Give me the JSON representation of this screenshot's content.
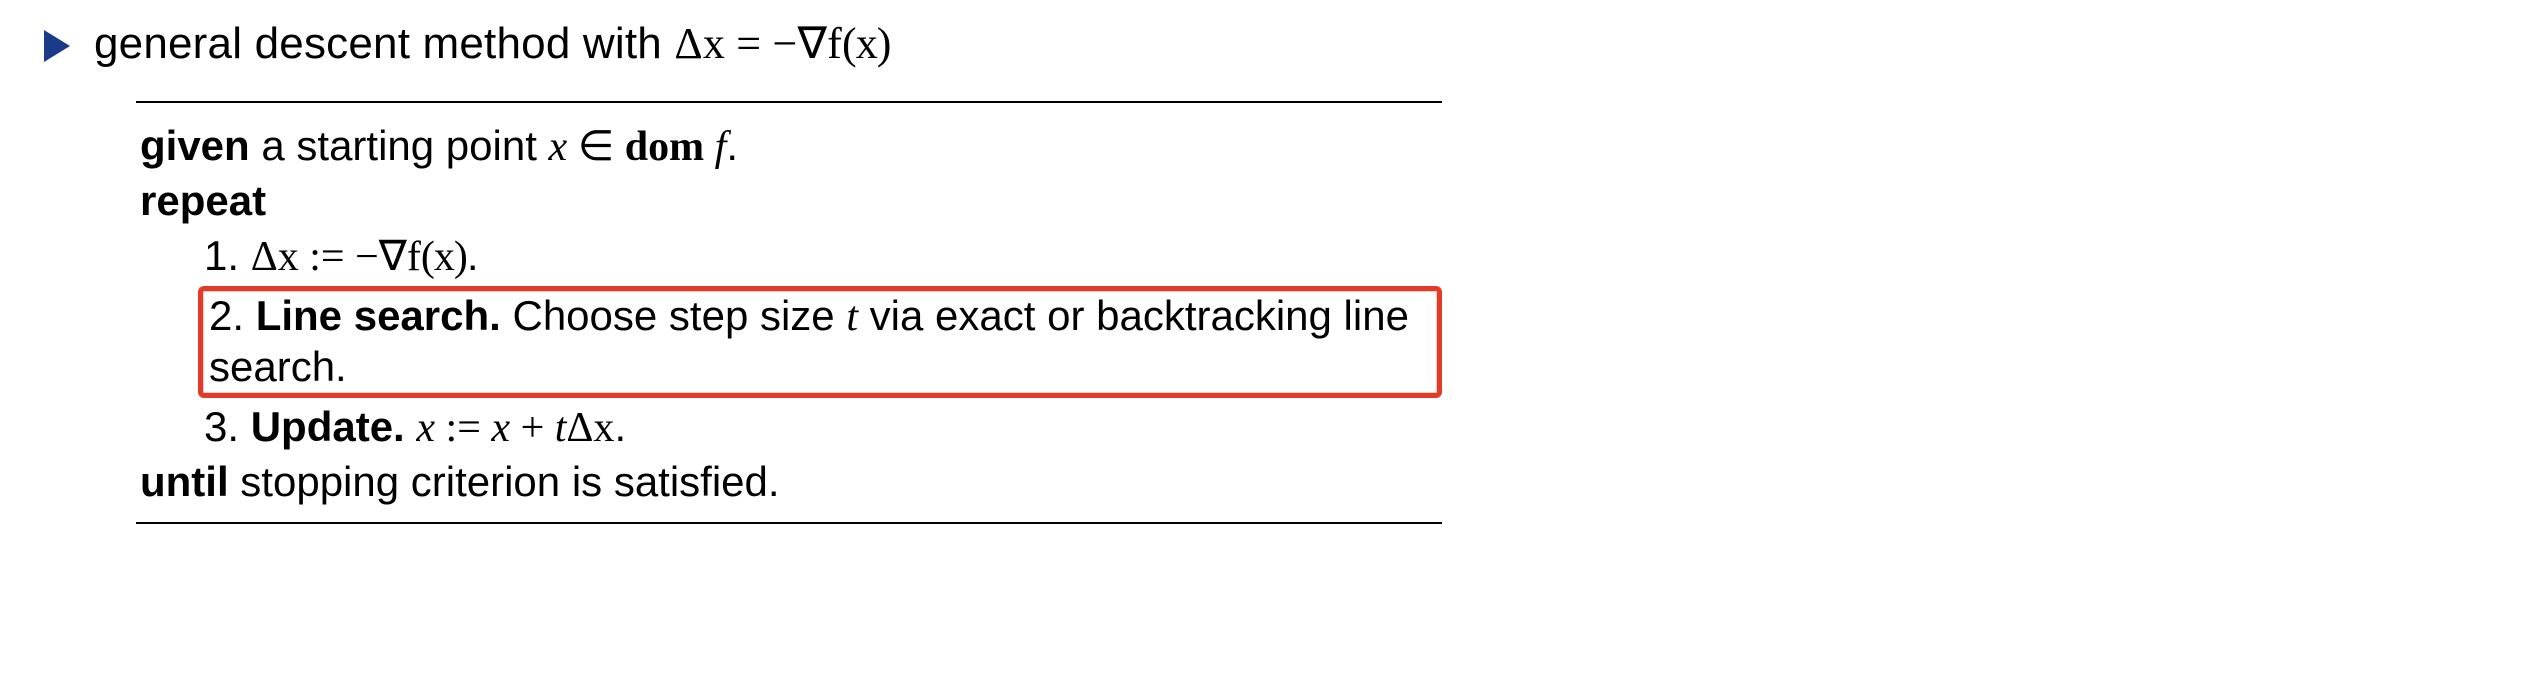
{
  "bullet": {
    "text_prefix": "general descent method with ",
    "delta_x": "Δx",
    "eq": " = ",
    "neg_grad": "−∇f",
    "of_x": "(x)"
  },
  "algorithm": {
    "given_bold": "given",
    "given_text_1": " a starting point ",
    "given_var_x": "x",
    "given_in": " ∈ ",
    "given_dom": "dom ",
    "given_f": "f",
    "given_period": ".",
    "repeat": "repeat",
    "steps": {
      "s1_num": "1. ",
      "s1_lhs": "Δx",
      "s1_assign": " := ",
      "s1_rhs_neg_grad": "−∇f",
      "s1_rhs_of_x": "(x)",
      "s1_period": ".",
      "s2_num": "2. ",
      "s2_title": "Line search.",
      "s2_text_1": " Choose step size ",
      "s2_var_t": "t",
      "s2_text_2": " via exact or backtracking line search.",
      "s3_num": "3. ",
      "s3_title": "Update.",
      "s3_sp": " ",
      "s3_lhs": "x",
      "s3_assign": " := ",
      "s3_rhs_x": "x",
      "s3_plus": " + ",
      "s3_rhs_t": "t",
      "s3_rhs_dx": "Δx",
      "s3_period": "."
    },
    "until_bold": "until",
    "until_text": " stopping criterion is satisfied."
  }
}
